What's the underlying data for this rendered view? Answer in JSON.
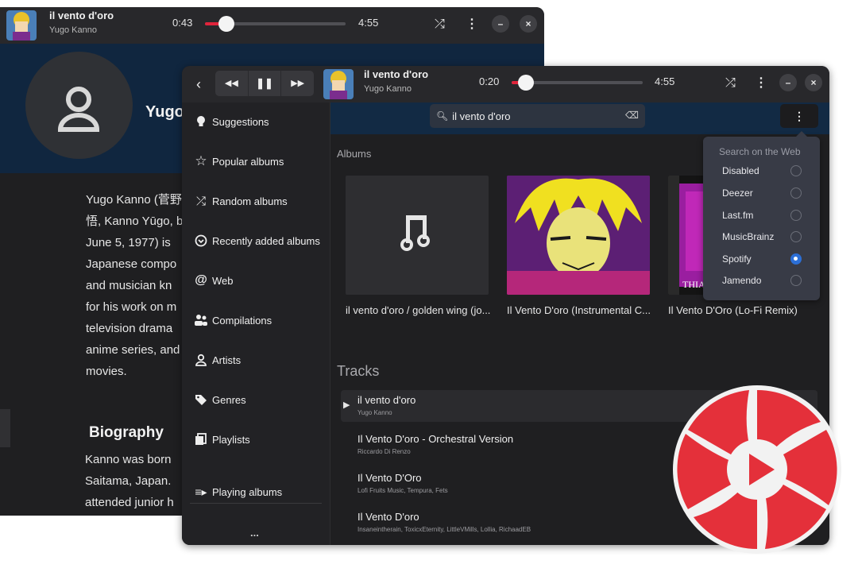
{
  "back_window": {
    "header": {
      "title": "il vento d'oro",
      "artist": "Yugo Kanno",
      "elapsed": "0:43",
      "duration": "4:55",
      "progress": 0.12
    },
    "artist_name": "Yugo",
    "bio_lines": "Yugo Kanno (菅野\n悟, Kanno Yūgo, b\nJune 5, 1977) is\nJapanese compo\nand musician kn\nfor his work on m\ntelevision drama\nanime series, and\nmovies.",
    "bio_title": "Biography",
    "bio2_lines": "Kanno was born\nSaitama, Japan.\nattended junior h"
  },
  "front_window": {
    "header": {
      "title": "il vento d'oro",
      "artist": "Yugo Kanno",
      "elapsed": "0:20",
      "duration": "4:55",
      "progress": 0.07
    },
    "sidebar": {
      "items": [
        {
          "label": "Suggestions",
          "icon": "lightbulb-icon"
        },
        {
          "label": "Popular albums",
          "icon": "star-icon"
        },
        {
          "label": "Random albums",
          "icon": "shuffle-icon"
        },
        {
          "label": "Recently added albums",
          "icon": "clock-icon"
        },
        {
          "label": "Web",
          "icon": "at-icon"
        },
        {
          "label": "Compilations",
          "icon": "people-icon"
        },
        {
          "label": "Artists",
          "icon": "person-icon"
        },
        {
          "label": "Genres",
          "icon": "tag-icon"
        },
        {
          "label": "Playlists",
          "icon": "playlist-icon"
        }
      ],
      "playing_albums": "Playing albums",
      "more": "..."
    },
    "search": {
      "value": "il vento d'oro"
    },
    "albums_title": "Albums",
    "albums": [
      {
        "name": "il vento d'oro / golden wing (jo..."
      },
      {
        "name": "Il Vento D'oro (Instrumental C..."
      },
      {
        "name": "Il Vento D'Oro (Lo-Fi Remix)",
        "art_text": "THIAGUINESS LO-FI REMIX"
      }
    ],
    "tracks_title": "Tracks",
    "tracks": [
      {
        "title": "il vento d'oro",
        "artist": "Yugo Kanno",
        "selected": true
      },
      {
        "title": "Il Vento D'oro - Orchestral Version",
        "artist": "Riccardo Di Renzo"
      },
      {
        "title": "Il Vento D'Oro",
        "artist": "Lofi Fruits Music, Tempura, Fets"
      },
      {
        "title": "Il Vento D'oro",
        "artist": "Insaneintherain, ToxicxEternity, LittleVMills, Lollia, RichaadEB"
      }
    ],
    "popover": {
      "title": "Search on the Web",
      "options": [
        {
          "label": "Disabled",
          "checked": false
        },
        {
          "label": "Deezer",
          "checked": false
        },
        {
          "label": "Last.fm",
          "checked": false
        },
        {
          "label": "MusicBrainz",
          "checked": false
        },
        {
          "label": "Spotify",
          "checked": true
        },
        {
          "label": "Jamendo",
          "checked": false
        }
      ]
    }
  },
  "colors": {
    "accent": "#e0243b",
    "radio_on": "#2c6fd6",
    "banner": "#10263f"
  }
}
